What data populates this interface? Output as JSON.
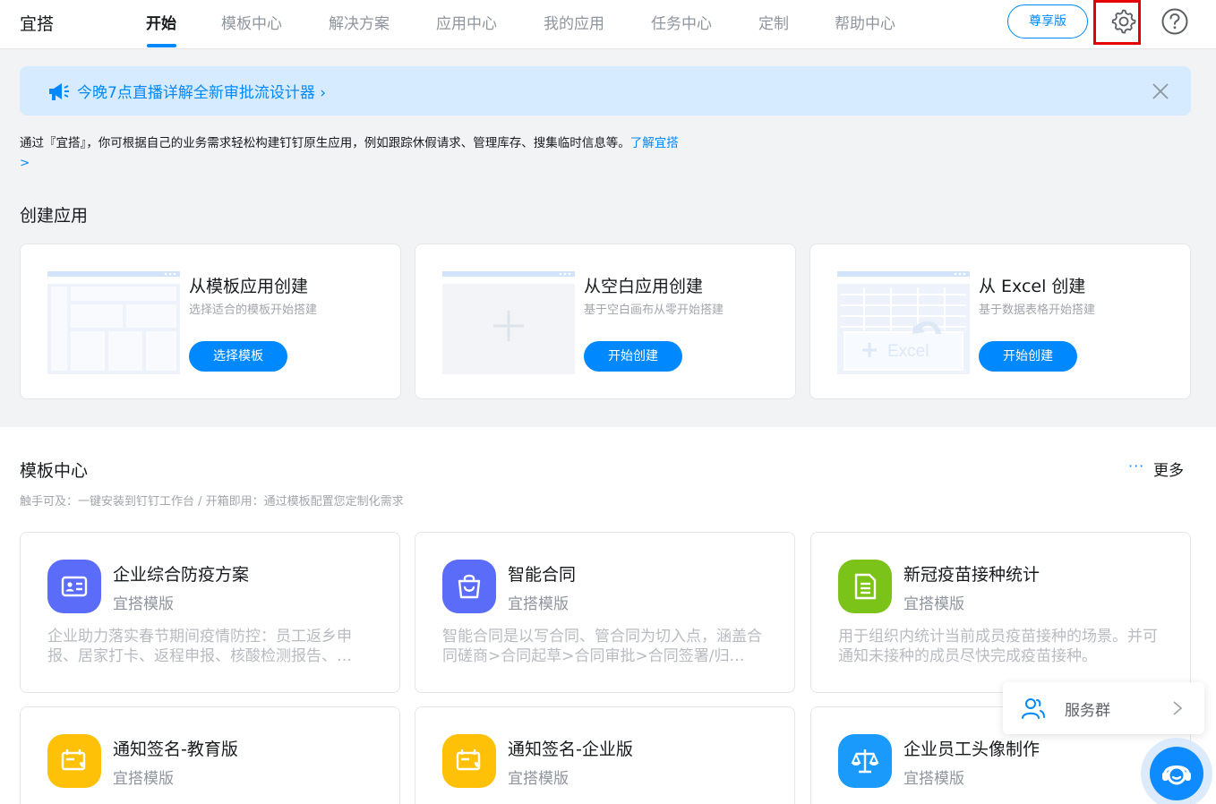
{
  "header": {
    "logo": "宜搭",
    "nav": [
      "开始",
      "模板中心",
      "解决方案",
      "应用中心",
      "我的应用",
      "任务中心",
      "定制",
      "帮助中心"
    ],
    "vip_label": "尊享版",
    "settings_icon": "gear-icon",
    "help_icon": "question-icon"
  },
  "banner": {
    "text": "今晚7点直播详解全新审批流设计器 ›",
    "icon": "megaphone-icon"
  },
  "intro": {
    "text": "通过『宜搭』，你可根据自己的业务需求轻松构建钉钉原生应用，例如跟踪休假请求、管理库存、搜集临时信息等。",
    "link": "了解宜搭 >"
  },
  "create": {
    "title": "创建应用",
    "cards": [
      {
        "title": "从模板应用创建",
        "desc": "选择适合的模板开始搭建",
        "button": "选择模板"
      },
      {
        "title": "从空白应用创建",
        "desc": "基于空白画布从零开始搭建",
        "button": "开始创建"
      },
      {
        "title": "从 Excel 创建",
        "desc": "基于数据表格开始搭建",
        "button": "开始创建",
        "thumb_text": "Excel"
      }
    ]
  },
  "templates": {
    "title": "模板中心",
    "more": "更多",
    "more_dots": "···",
    "subtitle": "触手可及：一键安装到钉钉工作台 / 开箱即用：通过模板配置您定制化需求",
    "cards": [
      {
        "title": "企业综合防疫方案",
        "tag": "宜搭模版",
        "desc": "企业助力落实春节期间疫情防控：员工返乡申报、居家打卡、返程申报、核酸检测报告、…",
        "color": "#5b6cf8",
        "icon": "id-card-icon"
      },
      {
        "title": "智能合同",
        "tag": "宜搭模版",
        "desc": "智能合同是以写合同、管合同为切入点，涵盖合同磋商>合同起草>合同审批>合同签署/归…",
        "color": "#5b6cf8",
        "icon": "bag-icon"
      },
      {
        "title": "新冠疫苗接种统计",
        "tag": "宜搭模版",
        "desc": "用于组织内统计当前成员疫苗接种的场景。并可通知未接种的成员尽快完成疫苗接种。",
        "color": "#7cc319",
        "icon": "document-icon"
      },
      {
        "title": "通知签名-教育版",
        "tag": "宜搭模版",
        "desc": "",
        "color": "#ffc107",
        "icon": "ticket-heart-icon"
      },
      {
        "title": "通知签名-企业版",
        "tag": "宜搭模版",
        "desc": "",
        "color": "#ffc107",
        "icon": "ticket-heart-icon"
      },
      {
        "title": "企业员工头像制作",
        "tag": "宜搭模版",
        "desc": "",
        "color": "#1a9bfc",
        "icon": "scale-icon"
      }
    ]
  },
  "service": {
    "label": "服务群",
    "icon": "people-icon"
  },
  "chat": {
    "icon": "customer-service-icon"
  }
}
